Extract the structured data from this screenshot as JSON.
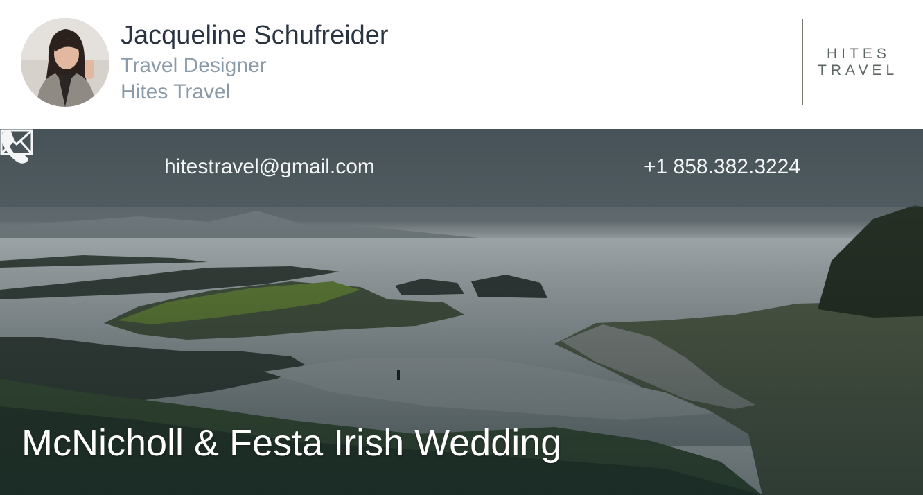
{
  "profile": {
    "name": "Jacqueline Schufreider",
    "role": "Travel Designer",
    "company": "Hites Travel",
    "avatar_icon": "person-photo"
  },
  "logo": {
    "line1": "HITES",
    "line2": "TRAVEL"
  },
  "contact": {
    "email": "hitestravel@gmail.com",
    "email_icon": "envelope-icon",
    "phone": "+1 858.382.3224",
    "phone_icon": "phone-icon"
  },
  "hero": {
    "title": "McNicholl & Festa Irish Wedding"
  },
  "colors": {
    "name_text": "#2a3440",
    "secondary_text": "#8a9aa8",
    "logo_text": "#5b6460",
    "bar_overlay": "#465258"
  }
}
